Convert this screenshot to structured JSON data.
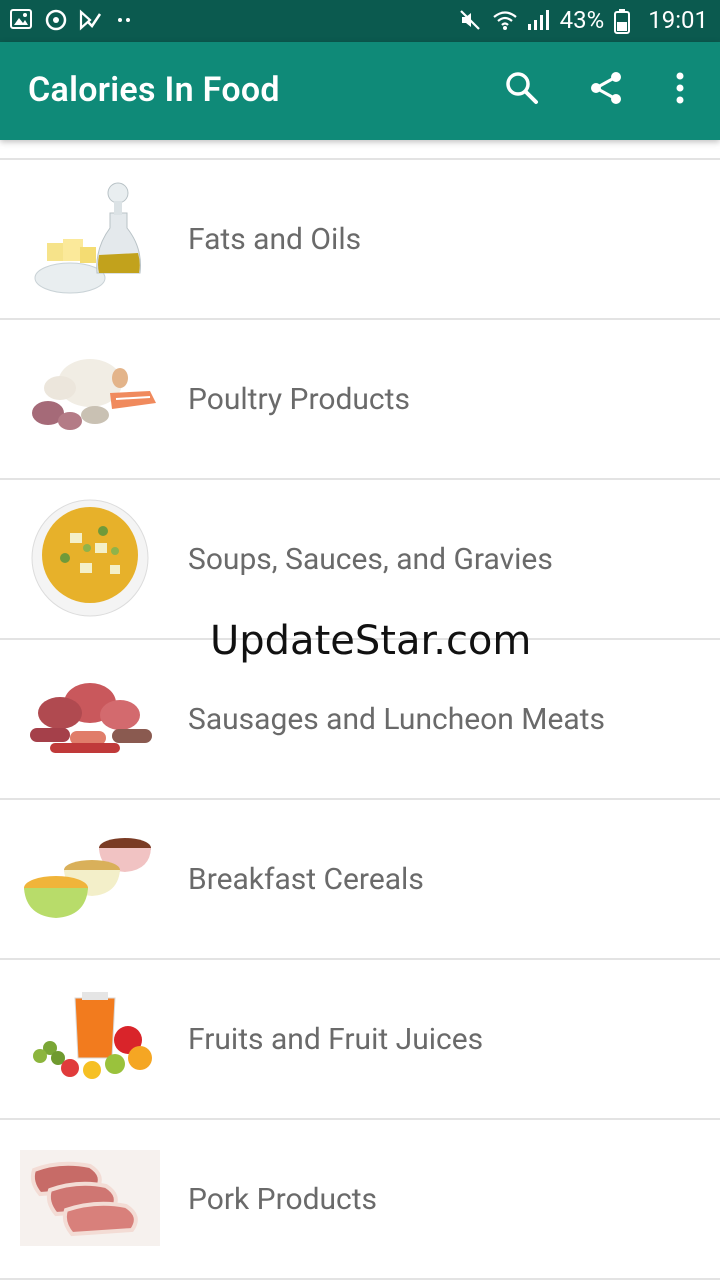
{
  "status_bar": {
    "battery": "43%",
    "time": "19:01"
  },
  "app_bar": {
    "title": "Calories In Food",
    "actions": [
      "search-icon",
      "share-icon",
      "more-vert-icon"
    ]
  },
  "categories": [
    {
      "label": "Fats and Oils",
      "icon": "oil-bottle-butter-image"
    },
    {
      "label": "Poultry Products",
      "icon": "poultry-fish-image"
    },
    {
      "label": "Soups, Sauces, and Gravies",
      "icon": "soup-bowl-image"
    },
    {
      "label": "Sausages and Luncheon Meats",
      "icon": "sausages-meats-image"
    },
    {
      "label": "Breakfast Cereals",
      "icon": "cereal-bowls-image"
    },
    {
      "label": "Fruits and Fruit Juices",
      "icon": "fruits-juice-image"
    },
    {
      "label": "Pork Products",
      "icon": "pork-chops-image"
    }
  ],
  "watermark": "UpdateStar.com",
  "colors": {
    "status_bar": "#0b5a4f",
    "app_bar": "#0f8a78",
    "label_text": "#6a6a6a",
    "divider": "#e3e3e3"
  }
}
